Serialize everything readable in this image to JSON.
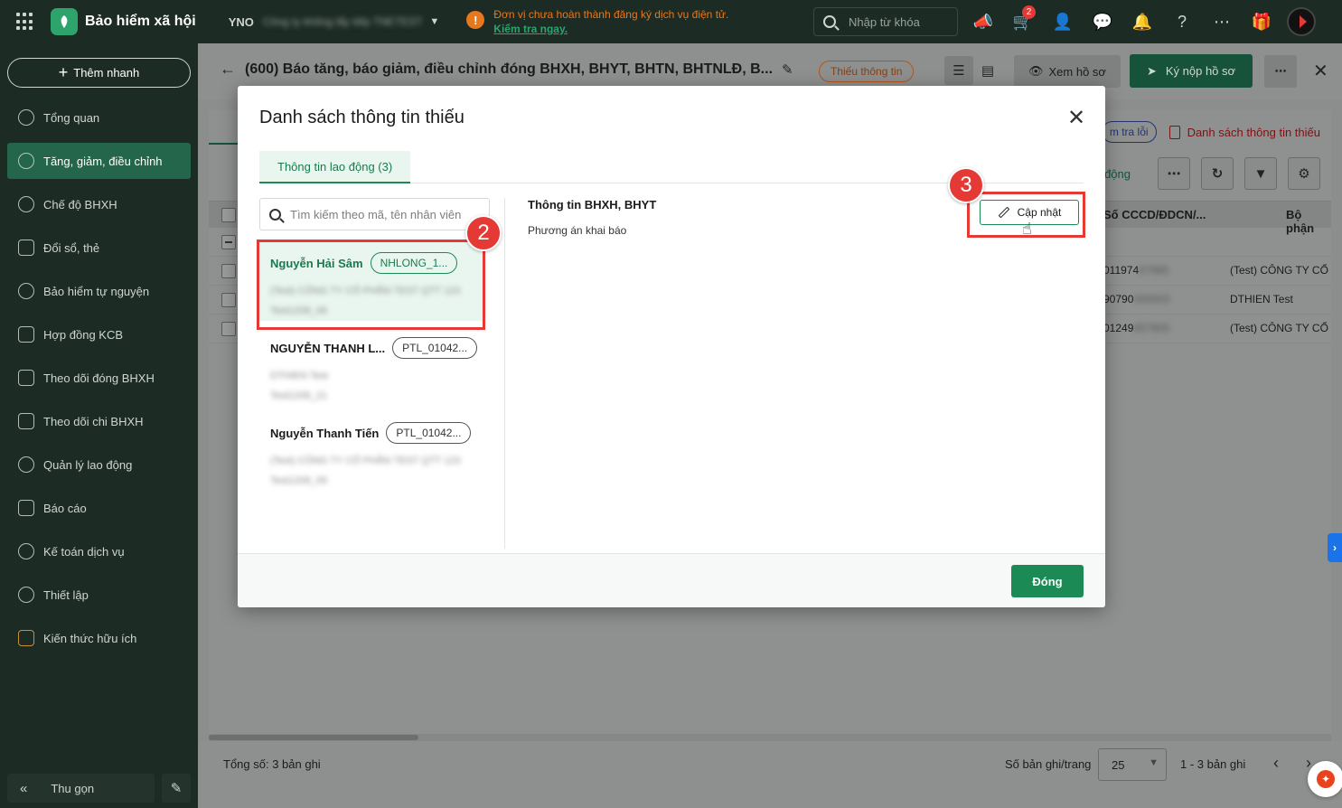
{
  "topbar": {
    "brand": "Bảo hiểm xã hội",
    "company_code": "YNO",
    "company_name_blurred": "Công ty không lấy tiếp TNETEST",
    "warning_line1": "Đơn vị chưa hoàn thành đăng ký dịch vụ điện tử.",
    "warning_link": "Kiểm tra ngay.",
    "search_placeholder": "Nhập từ khóa",
    "cart_badge": "2"
  },
  "sidebar": {
    "quick_add": "Thêm nhanh",
    "items": [
      {
        "label": "Tổng quan"
      },
      {
        "label": "Tăng, giảm, điều chỉnh"
      },
      {
        "label": "Chế độ BHXH"
      },
      {
        "label": "Đổi sổ, thẻ"
      },
      {
        "label": "Bảo hiểm tự nguyện"
      },
      {
        "label": "Hợp đồng KCB"
      },
      {
        "label": "Theo dõi đóng BHXH"
      },
      {
        "label": "Theo dõi chi BHXH"
      },
      {
        "label": "Quản lý lao động"
      },
      {
        "label": "Báo cáo"
      },
      {
        "label": "Kế toán dịch vụ"
      },
      {
        "label": "Thiết lập"
      },
      {
        "label": "Kiến thức hữu ích"
      }
    ],
    "collapse": "Thu gọn"
  },
  "main": {
    "title": "(600) Báo tăng, báo giảm, điều chỉnh đóng BHXH, BHYT, BHTN, BHTNLĐ, B...",
    "status_chip": "Thiếu thông tin",
    "view_doc": "Xem hồ sơ",
    "submit": "Ký nộp hồ sơ",
    "check_errors": "m tra lỗi",
    "missing_list": "Danh sách thông tin thiếu",
    "toolbar_link": "o động",
    "col_cccd": "Số CCCD/ĐDCN/...",
    "col_dept": "Bộ phận",
    "rows": [
      {
        "cccd_prefix": "011974",
        "cccd_blur": "67985",
        "dept_blur": "(Test) CÔNG TY CỔ"
      },
      {
        "cccd_prefix": "90790",
        "cccd_blur": "000003",
        "dept_blur": "DTHIEN Test"
      },
      {
        "cccd_prefix": "01249",
        "cccd_blur": "857805",
        "dept_blur": "(Test) CÔNG TY CỔ"
      }
    ]
  },
  "footer": {
    "total": "Tổng số: 3 bản ghi",
    "per_page_label": "Số bản ghi/trang",
    "per_page": "25",
    "range": "1 - 3 bản ghi"
  },
  "modal": {
    "title": "Danh sách thông tin thiếu",
    "tab": "Thông tin lao động (3)",
    "search_placeholder": "Tìm kiếm theo mã, tên nhân viên",
    "employees": [
      {
        "name": "Nguyễn Hải Sâm",
        "code": "NHLONG_1...",
        "sub1": "(Test) CÔNG TY CỔ PHẦN TEST QTT 123",
        "sub2": "Test1208_06"
      },
      {
        "name": "NGUYỄN THANH L...",
        "code": "PTL_01042...",
        "sub1": "DTHIEN Test",
        "sub2": "Test1208_21"
      },
      {
        "name": "Nguyễn Thanh Tiến",
        "code": "PTL_01042...",
        "sub1": "(Test) CÔNG TY CỔ PHẦN TEST QTT 123",
        "sub2": "Test1208_09"
      }
    ],
    "detail_heading": "Thông tin BHXH, BHYT",
    "detail_field": "Phương án khai báo",
    "update_button": "Cập nhật",
    "close_button": "Đóng"
  },
  "annotations": {
    "step2": "2",
    "step3": "3"
  }
}
